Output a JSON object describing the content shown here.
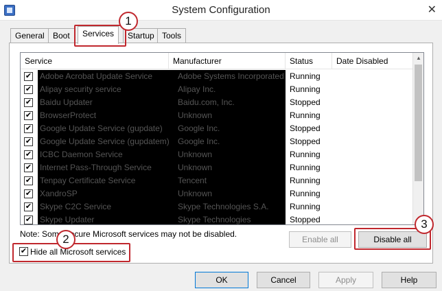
{
  "window": {
    "title": "System Configuration",
    "close_glyph": "✕"
  },
  "tabs": [
    {
      "label": "General"
    },
    {
      "label": "Boot"
    },
    {
      "label": "Services"
    },
    {
      "label": "Startup"
    },
    {
      "label": "Tools"
    }
  ],
  "columns": {
    "service": "Service",
    "manufacturer": "Manufacturer",
    "status": "Status",
    "date_disabled": "Date Disabled"
  },
  "services": [
    {
      "checked": true,
      "service": "Adobe Acrobat Update Service",
      "manufacturer": "Adobe Systems Incorporated",
      "status": "Running",
      "date_disabled": ""
    },
    {
      "checked": true,
      "service": "Alipay security service",
      "manufacturer": "Alipay Inc.",
      "status": "Running",
      "date_disabled": ""
    },
    {
      "checked": true,
      "service": "Baidu Updater",
      "manufacturer": "Baidu.com, Inc.",
      "status": "Stopped",
      "date_disabled": ""
    },
    {
      "checked": true,
      "service": "BrowserProtect",
      "manufacturer": "Unknown",
      "status": "Running",
      "date_disabled": ""
    },
    {
      "checked": true,
      "service": "Google Update Service (gupdate)",
      "manufacturer": "Google Inc.",
      "status": "Stopped",
      "date_disabled": ""
    },
    {
      "checked": true,
      "service": "Google Update Service (gupdatem)",
      "manufacturer": "Google Inc.",
      "status": "Stopped",
      "date_disabled": ""
    },
    {
      "checked": true,
      "service": "ICBC Daemon Service",
      "manufacturer": "Unknown",
      "status": "Running",
      "date_disabled": ""
    },
    {
      "checked": true,
      "service": "Internet Pass-Through Service",
      "manufacturer": "Unknown",
      "status": "Running",
      "date_disabled": ""
    },
    {
      "checked": true,
      "service": "Tenpay Certificate Service",
      "manufacturer": "Tencent",
      "status": "Running",
      "date_disabled": ""
    },
    {
      "checked": true,
      "service": "XandroSP",
      "manufacturer": "Unknown",
      "status": "Running",
      "date_disabled": ""
    },
    {
      "checked": true,
      "service": "Skype C2C Service",
      "manufacturer": "Skype Technologies S.A.",
      "status": "Running",
      "date_disabled": ""
    },
    {
      "checked": true,
      "service": "Skype Updater",
      "manufacturer": "Skype Technologies",
      "status": "Stopped",
      "date_disabled": ""
    }
  ],
  "note": "Note: Some secure Microsoft services may not be disabled.",
  "hide_ms": {
    "checked": true,
    "label": "Hide all Microsoft services"
  },
  "buttons": {
    "enable_all": "Enable all",
    "disable_all": "Disable all",
    "ok": "OK",
    "cancel": "Cancel",
    "apply": "Apply",
    "help": "Help"
  },
  "callouts": [
    "1",
    "2",
    "3"
  ],
  "colors": {
    "callout": "#c0272d",
    "redaction": "#000000"
  },
  "check_glyph": "✔"
}
